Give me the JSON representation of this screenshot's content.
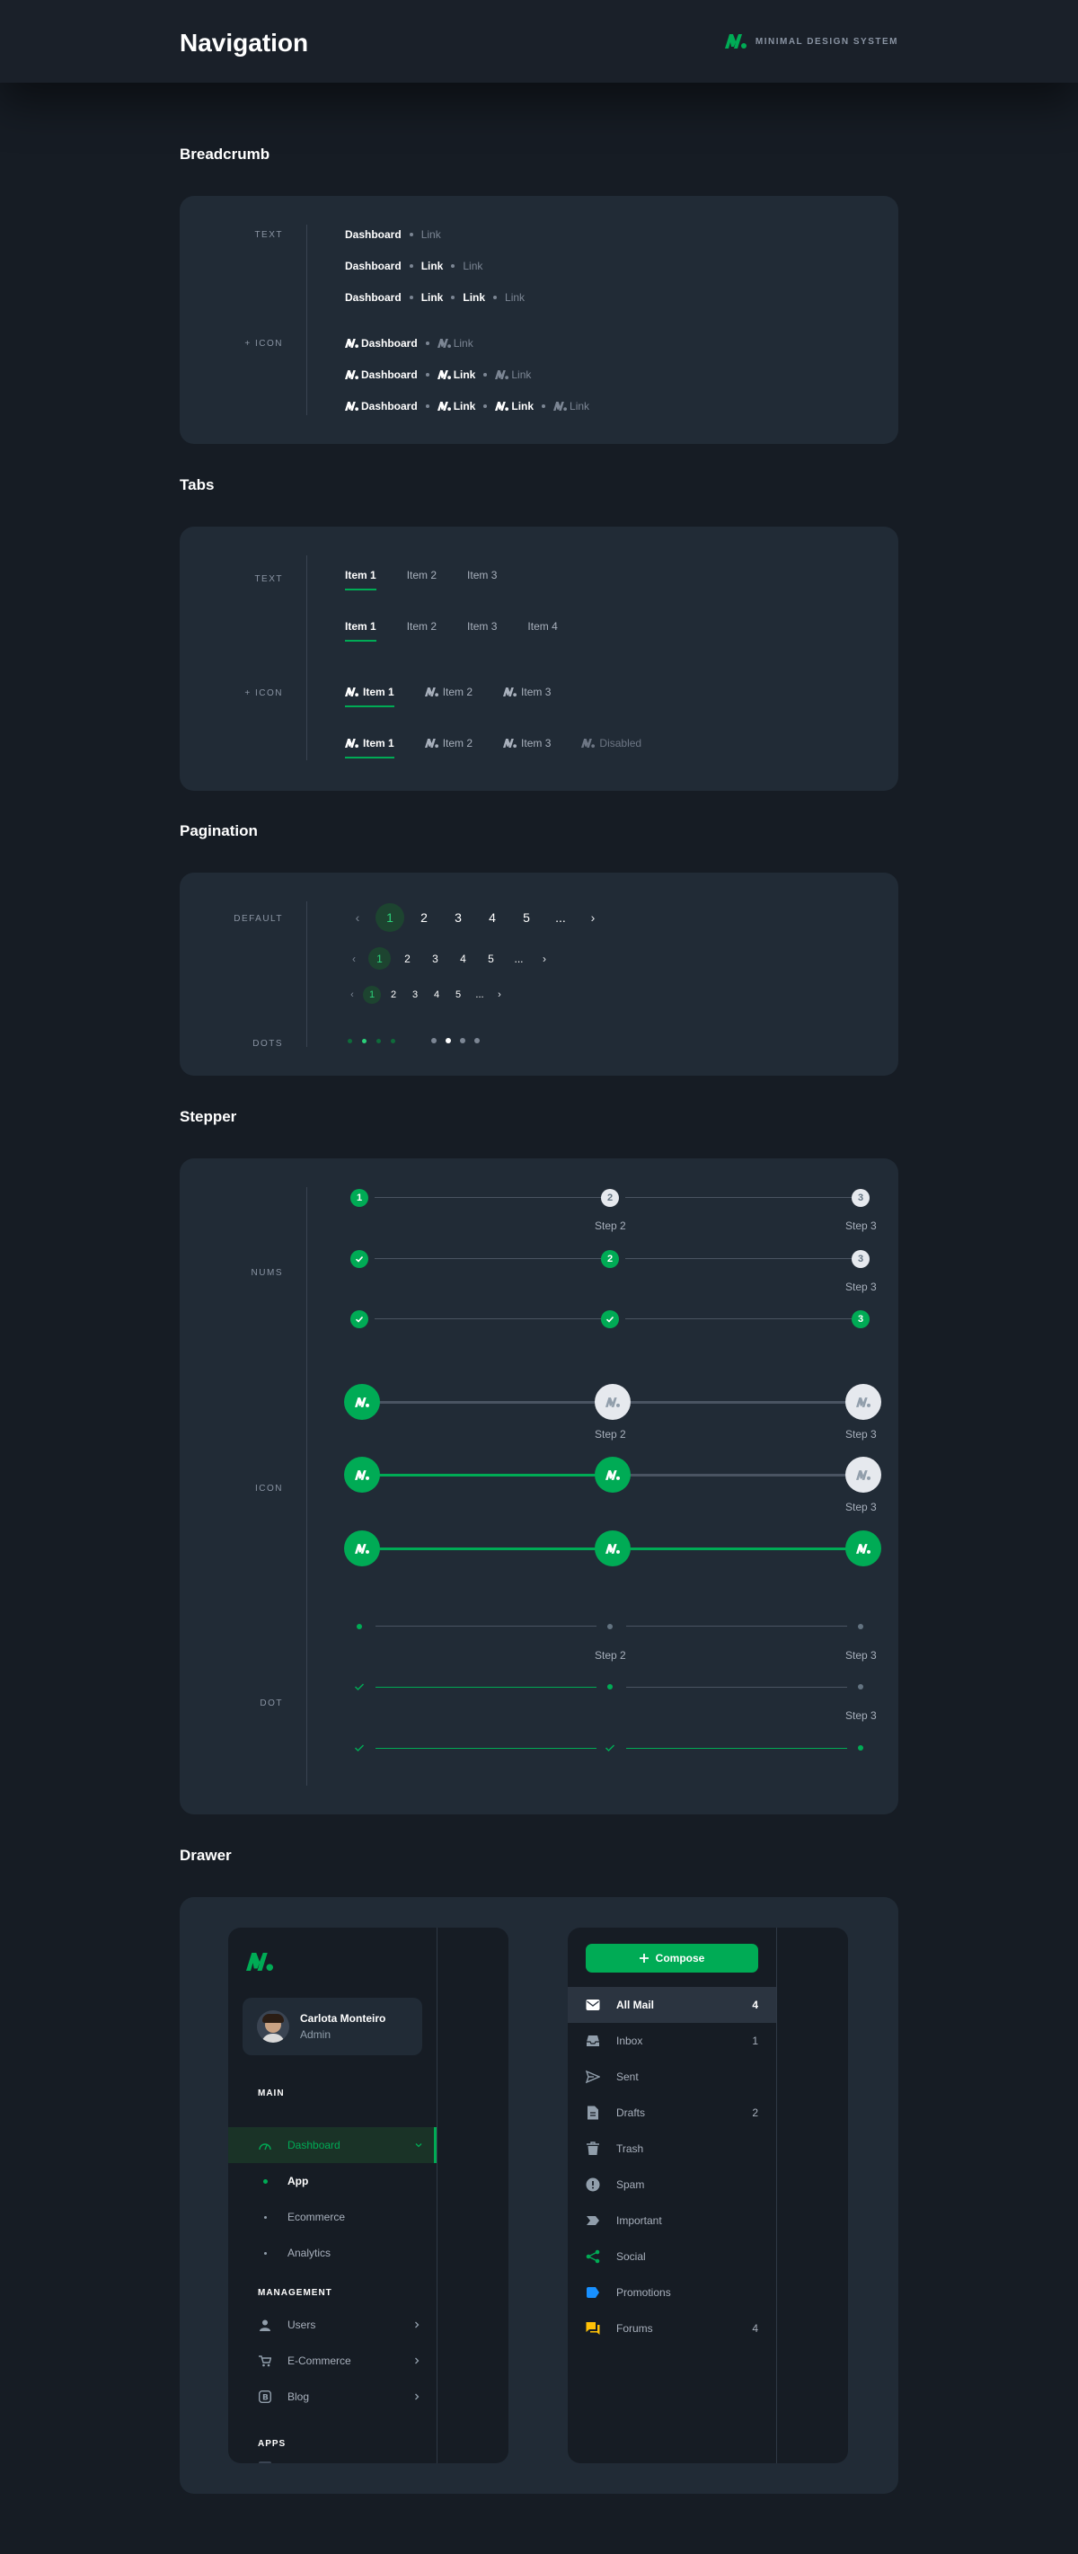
{
  "header": {
    "title": "Navigation",
    "brand": "MINIMAL DESIGN SYSTEM"
  },
  "colors": {
    "accent": "#00ab55",
    "card": "#212b36",
    "page": "#161c24"
  },
  "breadcrumb": {
    "title": "Breadcrumb",
    "label_text": "TEXT",
    "label_icon": "+ ICON",
    "dashboard": "Dashboard",
    "link": "Link"
  },
  "tabs": {
    "title": "Tabs",
    "label_text": "TEXT",
    "label_icon": "+ ICON",
    "items": [
      "Item 1",
      "Item 2",
      "Item 3",
      "Item 4"
    ],
    "disabled": "Disabled"
  },
  "pagination": {
    "title": "Pagination",
    "label_default": "DEFAULT",
    "label_dots": "DOTS",
    "pages": [
      "1",
      "2",
      "3",
      "4",
      "5"
    ],
    "ellipsis": "...",
    "prev": "‹",
    "next": "›"
  },
  "stepper": {
    "title": "Stepper",
    "label_nums": "NUMS",
    "label_icon": "ICON",
    "label_dot": "DOT",
    "step1_num": "1",
    "step2_num": "2",
    "step3_num": "3",
    "step2": "Step 2",
    "step3": "Step 3"
  },
  "drawer": {
    "title": "Drawer",
    "user_name": "Carlota Monteiro",
    "user_role": "Admin",
    "section_main": "MAIN",
    "dashboard": "Dashboard",
    "app": "App",
    "ecommerce": "Ecommerce",
    "analytics": "Analytics",
    "section_management": "MANAGEMENT",
    "users": "Users",
    "ecommerce2": "E-Commerce",
    "blog": "Blog",
    "section_apps": "APPS",
    "compose": "Compose",
    "mail": [
      {
        "label": "All Mail",
        "count": "4"
      },
      {
        "label": "Inbox",
        "count": "1"
      },
      {
        "label": "Sent",
        "count": ""
      },
      {
        "label": "Drafts",
        "count": "2"
      },
      {
        "label": "Trash",
        "count": ""
      },
      {
        "label": "Spam",
        "count": ""
      },
      {
        "label": "Important",
        "count": ""
      },
      {
        "label": "Social",
        "count": ""
      },
      {
        "label": "Promotions",
        "count": ""
      },
      {
        "label": "Forums",
        "count": "4"
      }
    ]
  }
}
